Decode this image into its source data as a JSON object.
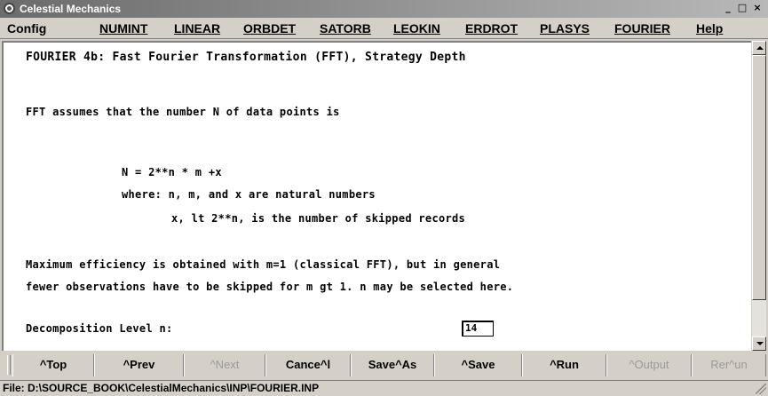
{
  "window": {
    "title": "Celestial Mechanics"
  },
  "menu": [
    {
      "label": "Config",
      "ul": false
    },
    {
      "label": "NUMINT",
      "ul": true
    },
    {
      "label": "LINEAR",
      "ul": true
    },
    {
      "label": "ORBDET",
      "ul": true
    },
    {
      "label": "SATORB",
      "ul": true
    },
    {
      "label": "LEOKIN",
      "ul": true
    },
    {
      "label": "ERDROT",
      "ul": true
    },
    {
      "label": "PLASYS",
      "ul": true
    },
    {
      "label": "FOURIER",
      "ul": true
    },
    {
      "label": "Help",
      "ul": true
    }
  ],
  "content": {
    "heading": "FOURIER 4b: Fast Fourier Transformation (FFT), Strategy Depth",
    "intro": "FFT assumes that the number N of data points is",
    "formula": "N = 2**n * m +x",
    "where_line": "where: n, m, and x are natural numbers",
    "skip_line": "x, lt 2**n, is the number of skipped records",
    "efficiency_1": "Maximum efficiency is obtained with m=1 (classical FFT), but in general",
    "efficiency_2": "fewer observations have to be skipped for m gt 1. n may be selected here.",
    "level_label": "Decomposition Level n:",
    "level_value": "14"
  },
  "toolbar": {
    "top": "^Top",
    "prev": "^Prev",
    "next": "^Next",
    "cancel": "Cance^l",
    "saveas": "Save^As",
    "save": "^Save",
    "run": "^Run",
    "output": "^Output",
    "rerun": "Rer^un"
  },
  "status": {
    "file": "File: D:\\SOURCE_BOOK\\CelestialMechanics\\INP\\FOURIER.INP"
  },
  "colors": {
    "title_bar": "#8a8a8a",
    "chrome": "#d4d0c8",
    "content_bg": "#ffffff",
    "disabled_text": "#9a9a9a"
  }
}
